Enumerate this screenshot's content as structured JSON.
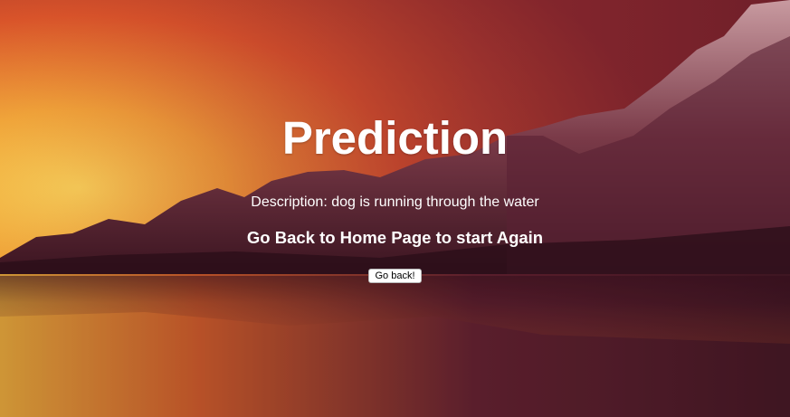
{
  "page": {
    "title": "Prediction",
    "description_label": "Description:",
    "description_value": "dog is running through the water",
    "subtitle": "Go Back to Home Page to start Again",
    "back_button_label": "Go back!"
  },
  "colors": {
    "text": "#ffffff",
    "sky_hot": "#f2b43a",
    "sky_mid": "#d9542a",
    "sky_dark": "#7a1f24",
    "mountain": "#6b2f3c",
    "water": "#5a2230"
  }
}
